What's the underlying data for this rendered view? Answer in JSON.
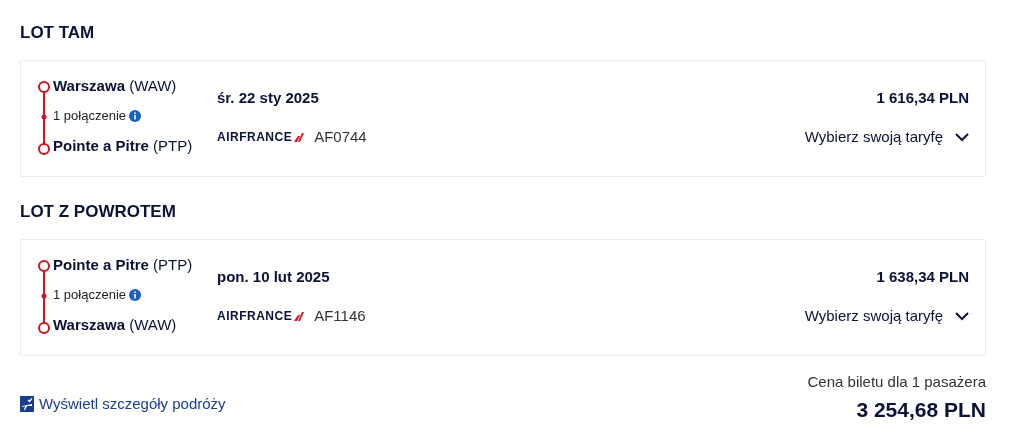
{
  "flights": [
    {
      "title": "LOT TAM",
      "origin": {
        "city": "Warszawa",
        "code": "(WAW)"
      },
      "connections": "1 połączenie",
      "destination": {
        "city": "Pointe a Pitre",
        "code": "(PTP)"
      },
      "date": "śr. 22 sty 2025",
      "airline": "AIRFRANCE",
      "flight_number": "AF0744",
      "price": "1 616,34 PLN",
      "fare_button": "Wybierz swoją taryfę",
      "expanded": false
    },
    {
      "title": "LOT Z POWROTEM",
      "origin": {
        "city": "Pointe a Pitre",
        "code": "(PTP)"
      },
      "connections": "1 połączenie",
      "destination": {
        "city": "Warszawa",
        "code": "(WAW)"
      },
      "date": "pon. 10 lut 2025",
      "airline": "AIRFRANCE",
      "flight_number": "AF1146",
      "price": "1 638,34 PLN",
      "fare_button": "Wybierz swoją taryfę",
      "expanded": false
    }
  ],
  "details_link": "Wyświetl szczegóły podróży",
  "total": {
    "label": "Cena biletu dla 1 pasażera",
    "amount": "3 254,68 PLN"
  }
}
